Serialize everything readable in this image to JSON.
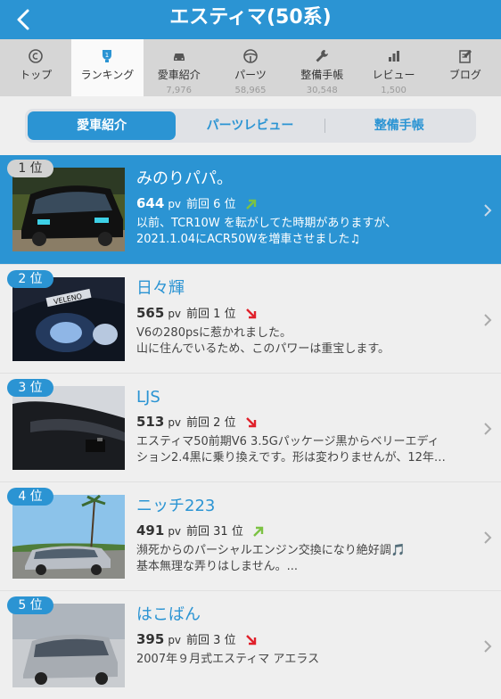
{
  "header": {
    "title": "エスティマ(50系)"
  },
  "tabs": [
    {
      "label": "トップ",
      "count": "",
      "icon": "top-icon"
    },
    {
      "label": "ランキング",
      "count": "",
      "icon": "ranking-icon"
    },
    {
      "label": "愛車紹介",
      "count": "7,976",
      "icon": "car-icon"
    },
    {
      "label": "パーツ",
      "count": "58,965",
      "icon": "steering-wheel-icon"
    },
    {
      "label": "整備手帳",
      "count": "30,548",
      "icon": "wrench-icon"
    },
    {
      "label": "レビュー",
      "count": "1,500",
      "icon": "review-icon"
    },
    {
      "label": "ブログ",
      "count": "",
      "icon": "blog-icon"
    }
  ],
  "segment": {
    "options": [
      "愛車紹介",
      "パーツレビュー",
      "整備手帳"
    ],
    "selected": "愛車紹介"
  },
  "rankings": [
    {
      "rank": "1 位",
      "name": "みのりパパ。",
      "pv": "644",
      "pv_unit": "pv",
      "prev": "前回 6 位",
      "trend": "up",
      "desc1": "以前、TCR10W を転がしてた時期がありますが、",
      "desc2": "2021.1.04にACR50Wを増車させました♫"
    },
    {
      "rank": "2 位",
      "name": "日々輝",
      "pv": "565",
      "pv_unit": "pv",
      "prev": "前回 1 位",
      "trend": "down",
      "desc1": "V6の280psに惹かれました。",
      "desc2": "山に住んでいるため、このパワーは重宝します。"
    },
    {
      "rank": "3 位",
      "name": "LJS",
      "pv": "513",
      "pv_unit": "pv",
      "prev": "前回 2 位",
      "trend": "down",
      "desc1": "エスティマ50前期V6 3.5Gパッケージ黒からベリーエディ",
      "desc2": "ション2.4黒に乗り換えです。形は変わりませんが、12年…"
    },
    {
      "rank": "4 位",
      "name": "ニッチ223",
      "pv": "491",
      "pv_unit": "pv",
      "prev": "前回 31 位",
      "trend": "up",
      "desc1": "瀕死からのパーシャルエンジン交換になり絶好調🎵",
      "desc2": "基本無理な弄りはしません。..."
    },
    {
      "rank": "5 位",
      "name": "はこばん",
      "pv": "395",
      "pv_unit": "pv",
      "prev": "前回 3 位",
      "trend": "down",
      "desc1": "2007年９月式エスティマ アエラス",
      "desc2": ""
    }
  ],
  "colors": {
    "accent": "#2b94d3",
    "up": "#7cc243",
    "down": "#e0202a"
  }
}
